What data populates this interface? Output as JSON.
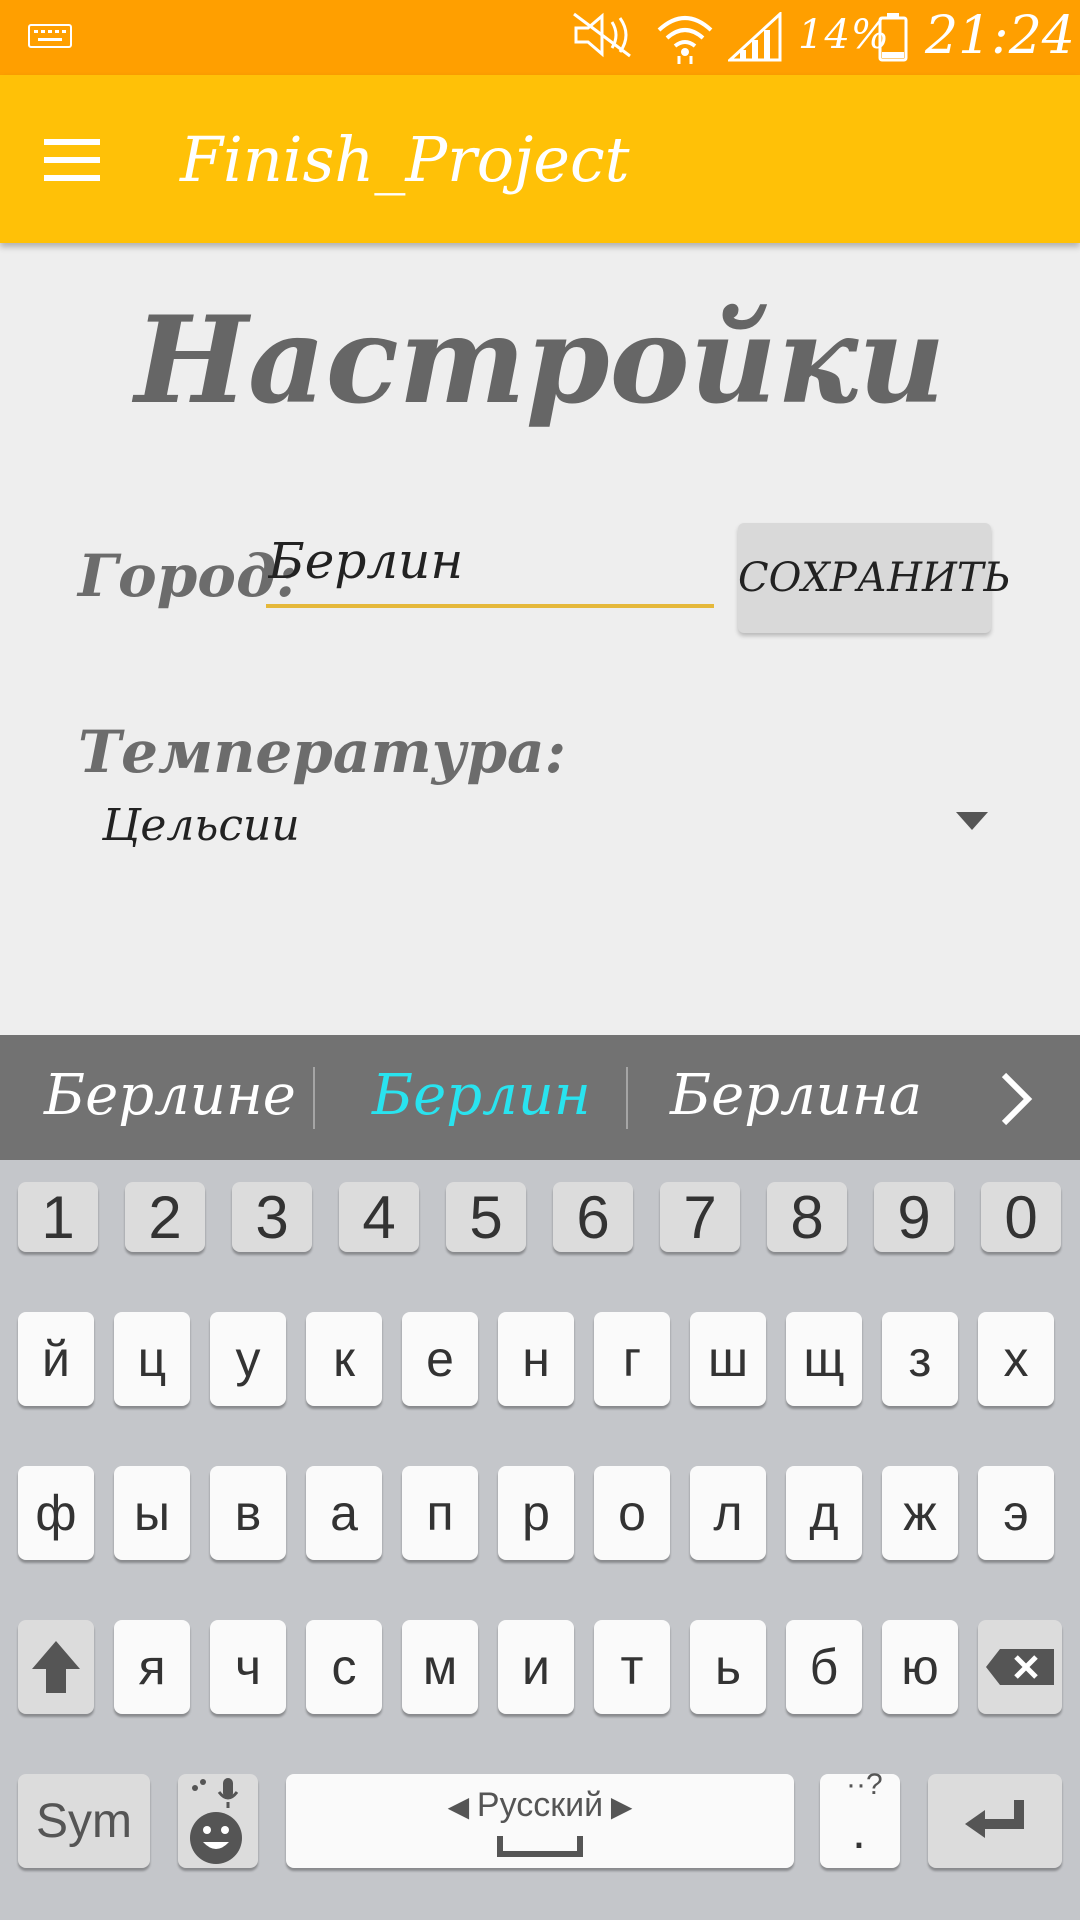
{
  "status_bar": {
    "battery_percent": "14%",
    "time": "21:24",
    "icons": [
      "keyboard-icon",
      "mute-icon",
      "wifi-icon",
      "signal-icon",
      "battery-icon"
    ]
  },
  "app_bar": {
    "title": "Finish_Project",
    "menu_icon": "hamburger-menu-icon",
    "color": "#ffc107"
  },
  "settings": {
    "title": "Настройки",
    "city_label": "Город:",
    "city_value": "Берлин",
    "save_button": "СОХРАНИТЬ",
    "temperature_label": "Температура:",
    "temperature_value": "Цельсии"
  },
  "suggestions": {
    "items": [
      "Берлине",
      "Берлин",
      "Берлина"
    ],
    "highlight_color": "#29e3ef"
  },
  "keyboard": {
    "numbers": [
      "1",
      "2",
      "3",
      "4",
      "5",
      "6",
      "7",
      "8",
      "9",
      "0"
    ],
    "row1": [
      "й",
      "ц",
      "у",
      "к",
      "е",
      "н",
      "г",
      "ш",
      "щ",
      "з",
      "х"
    ],
    "row2": [
      "ф",
      "ы",
      "в",
      "а",
      "п",
      "р",
      "о",
      "л",
      "д",
      "ж",
      "э"
    ],
    "row3": [
      "я",
      "ч",
      "с",
      "м",
      "и",
      "т",
      "ь",
      "б",
      "ю"
    ],
    "sym_label": "Sym",
    "language_label": "Русский",
    "period_label": "."
  }
}
